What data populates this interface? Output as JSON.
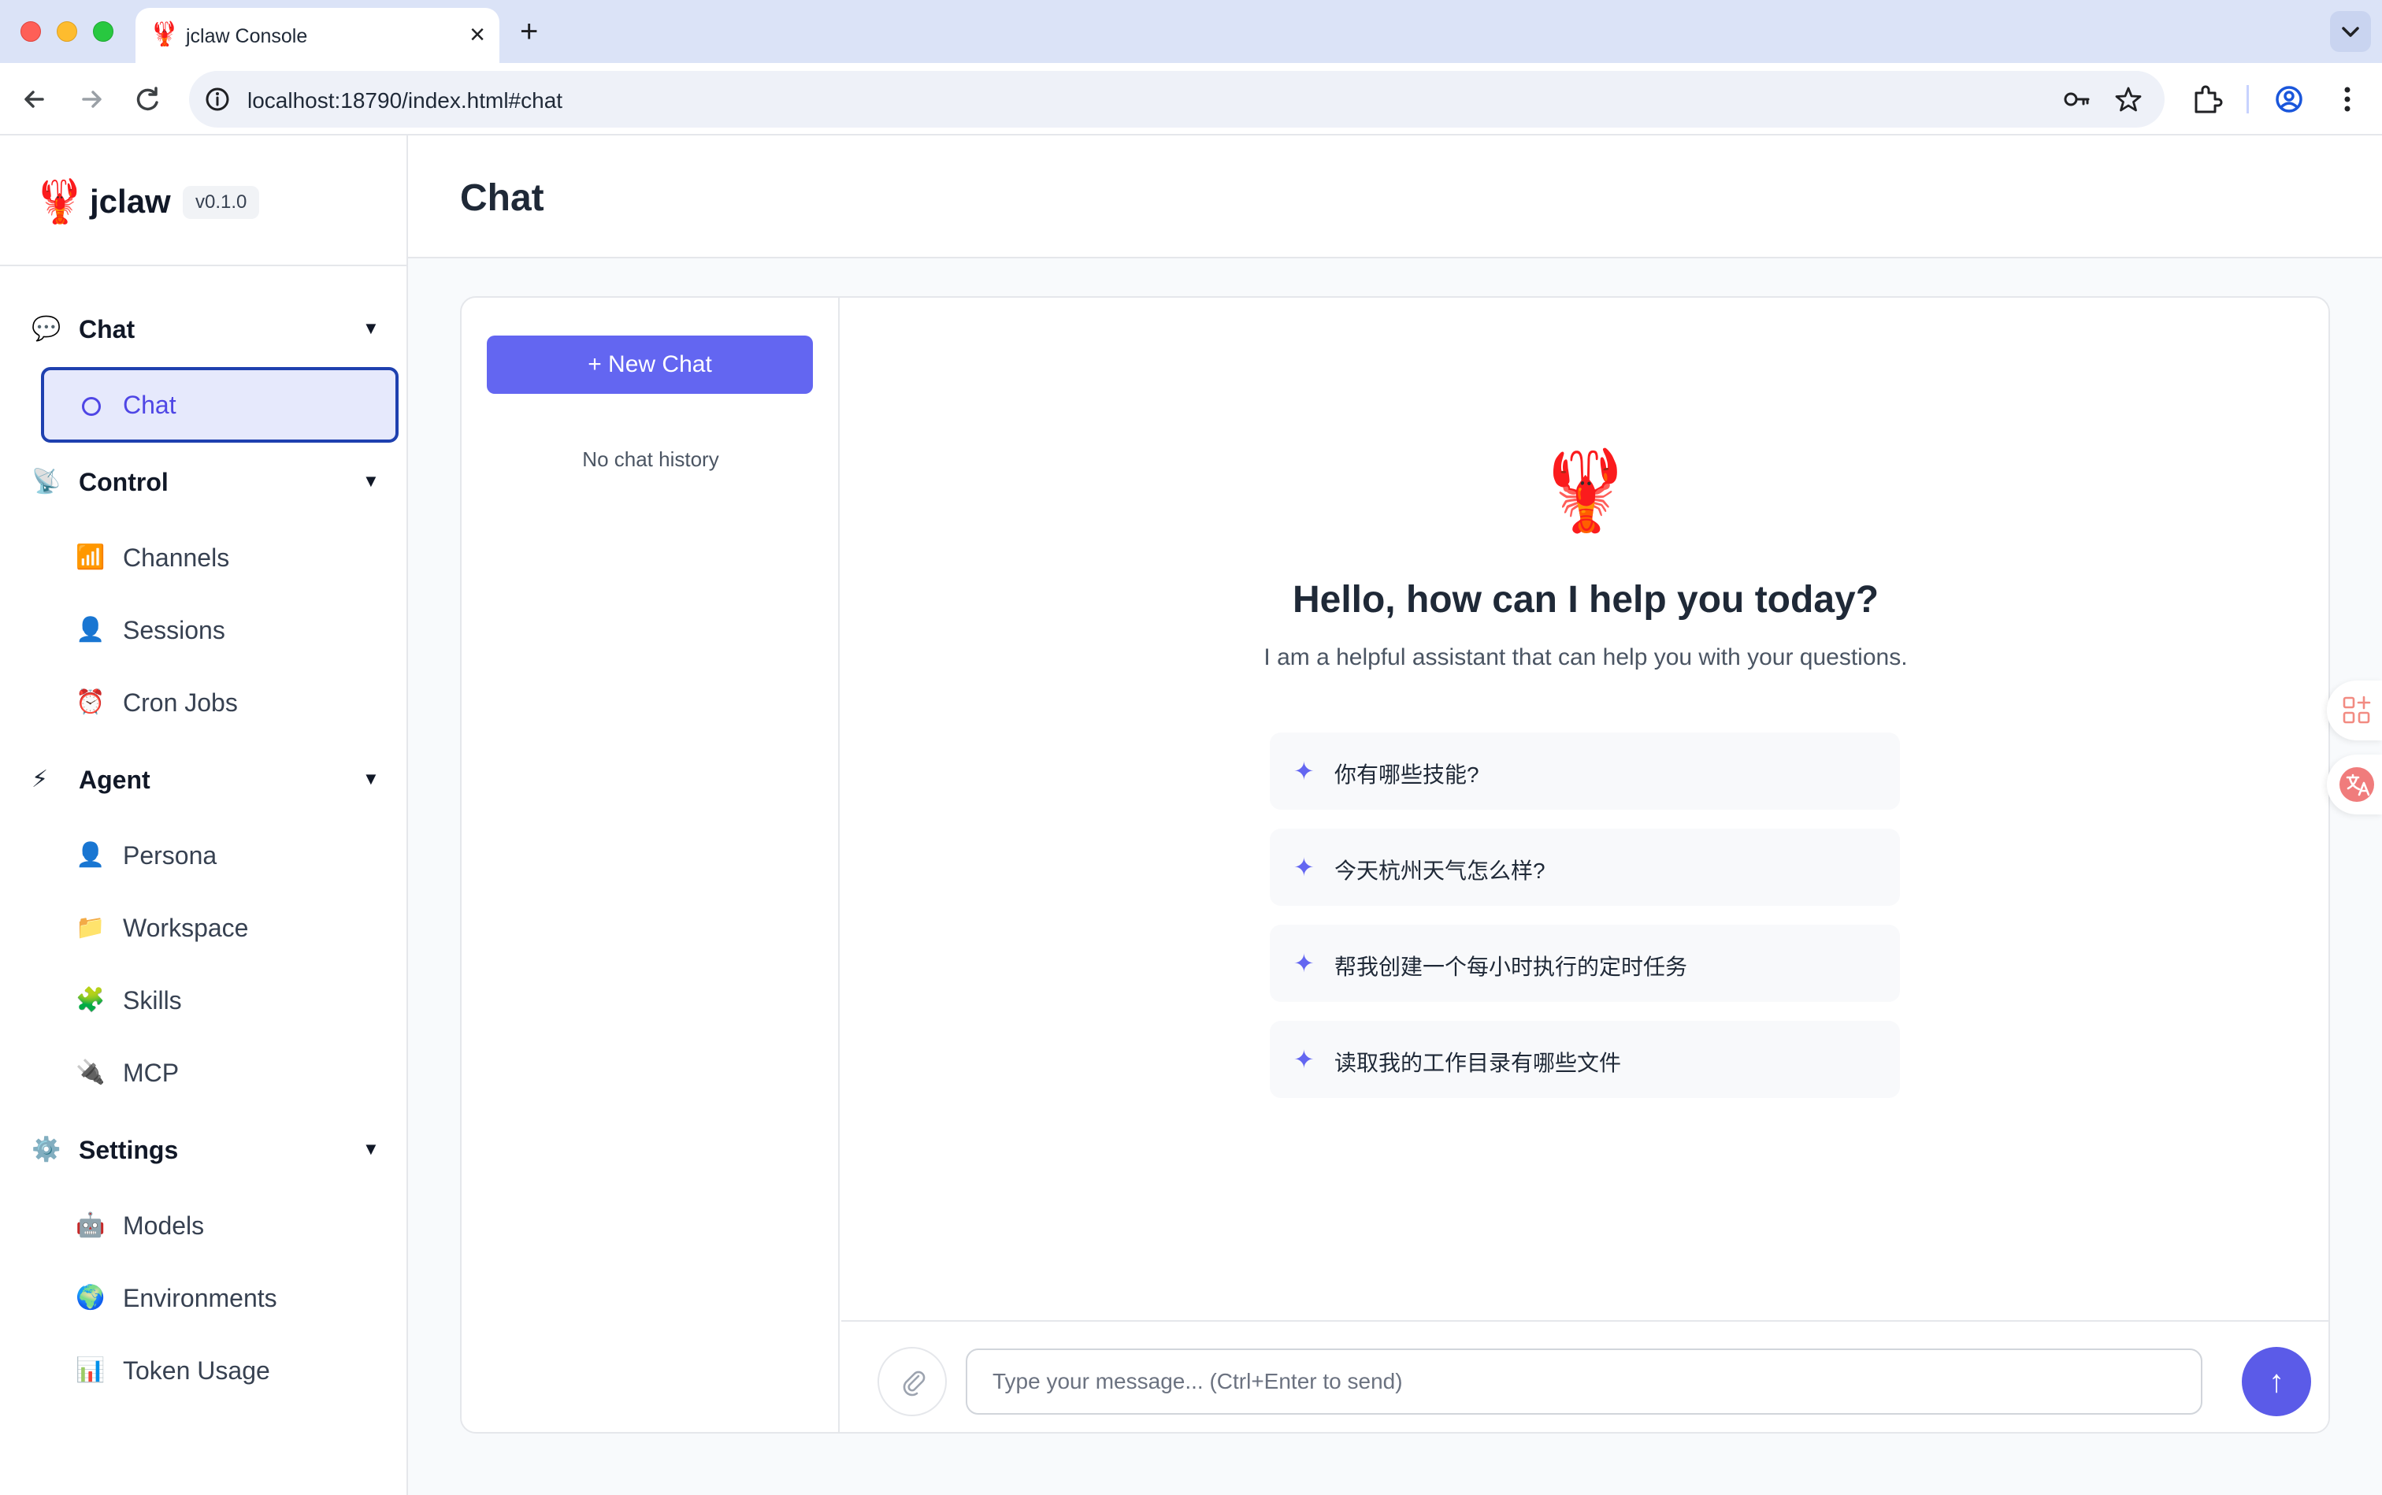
{
  "browser": {
    "tab_title": "jclaw Console",
    "tab_favicon": "🦞",
    "tab_close": "×",
    "new_tab": "+",
    "url": "localhost:18790/index.html#chat"
  },
  "sidebar": {
    "brand_logo": "🦞",
    "brand_name": "jclaw",
    "version": "v0.1.0",
    "groups": [
      {
        "icon": "💬",
        "label": "Chat",
        "caret": "▼",
        "items": [
          {
            "label": "Chat",
            "active": true
          }
        ]
      },
      {
        "icon": "📡",
        "label": "Control",
        "caret": "▼",
        "items": [
          {
            "icon": "📶",
            "label": "Channels"
          },
          {
            "icon": "👤",
            "label": "Sessions"
          },
          {
            "icon": "⏰",
            "label": "Cron Jobs"
          }
        ]
      },
      {
        "icon": "⚡",
        "label": "Agent",
        "caret": "▼",
        "items": [
          {
            "icon": "👤",
            "label": "Persona"
          },
          {
            "icon": "📁",
            "label": "Workspace"
          },
          {
            "icon": "🧩",
            "label": "Skills"
          },
          {
            "icon": "🔌",
            "label": "MCP"
          }
        ]
      },
      {
        "icon": "⚙️",
        "label": "Settings",
        "caret": "▼",
        "items": [
          {
            "icon": "🤖",
            "label": "Models"
          },
          {
            "icon": "🌍",
            "label": "Environments"
          },
          {
            "icon": "📊",
            "label": "Token Usage"
          }
        ]
      }
    ]
  },
  "main": {
    "title": "Chat",
    "new_chat_label": "+ New Chat",
    "no_history": "No chat history",
    "welcome_logo": "🦞",
    "welcome_title": "Hello, how can I help you today?",
    "welcome_subtitle": "I am a helpful assistant that can help you with your questions.",
    "suggestion_icon": "✦",
    "suggestions": [
      "你有哪些技能?",
      "今天杭州天气怎么样?",
      "帮我创建一个每小时执行的定时任务",
      "读取我的工作目录有哪些文件"
    ],
    "input_placeholder": "Type your message... (Ctrl+Enter to send)",
    "input_value": "",
    "send_icon": "↑"
  },
  "colors": {
    "accent": "#6366f1",
    "active_border": "#1e40af",
    "active_bg": "#e6e9fc",
    "tabbar_bg": "#dbe3f7"
  }
}
